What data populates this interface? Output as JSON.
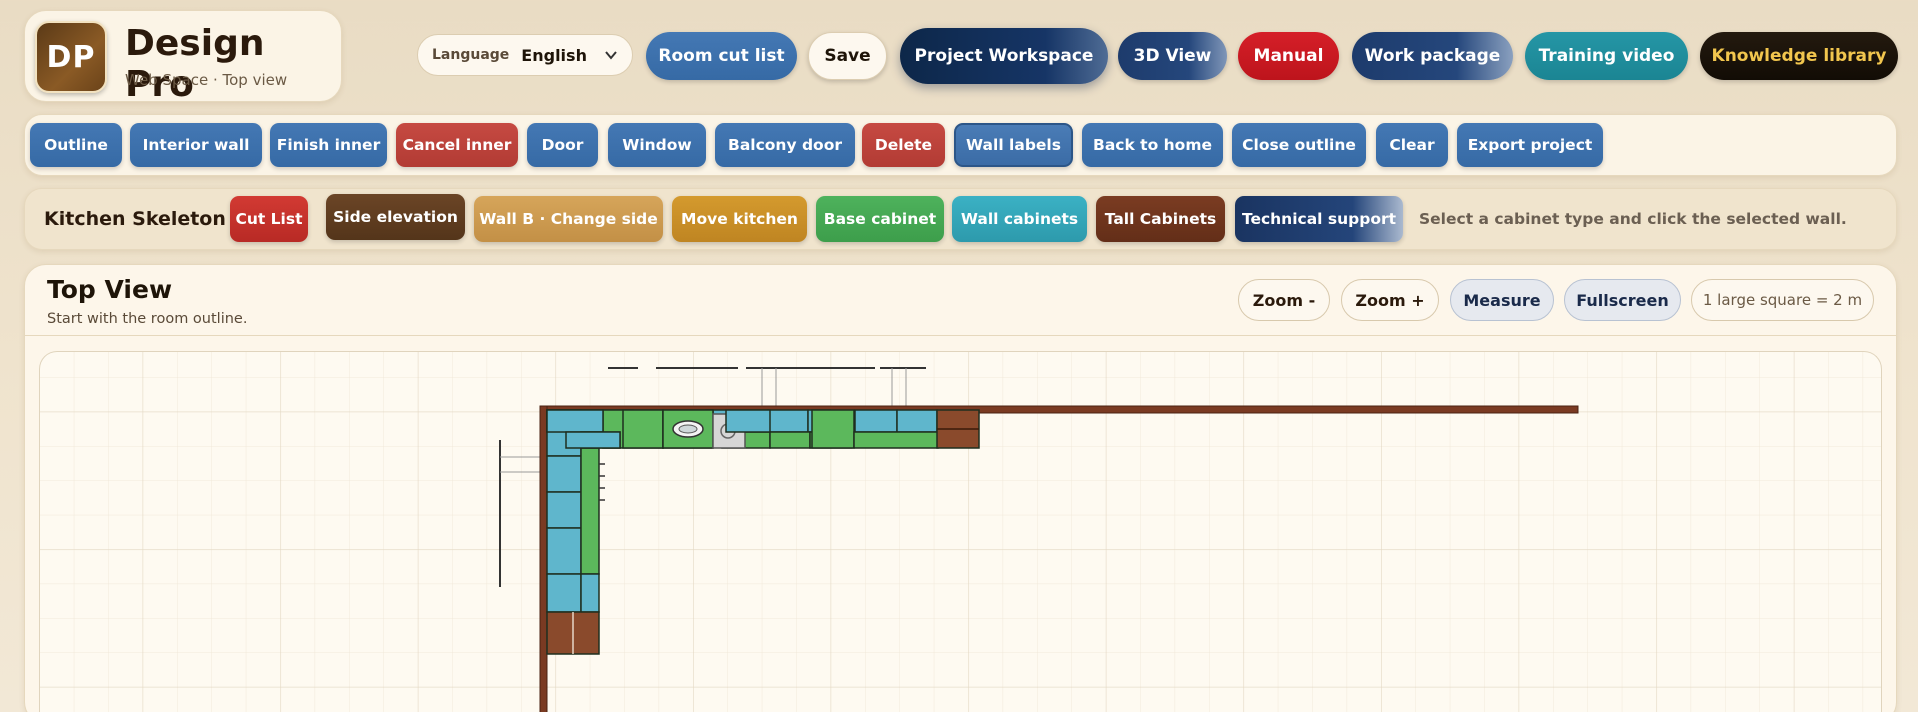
{
  "brand": {
    "logo": "DP",
    "title": "Design Pro",
    "subtitle": "Web Space · Top view"
  },
  "language": {
    "label": "Language",
    "value": "English"
  },
  "header_buttons": {
    "room_cut_list": "Room cut list",
    "save": "Save",
    "project_workspace": "Project Workspace",
    "view_3d": "3D View",
    "manual": "Manual",
    "work_package": "Work package",
    "training_video": "Training video",
    "knowledge_library": "Knowledge library"
  },
  "tools": {
    "outline": "Outline",
    "interior_wall": "Interior wall",
    "finish_inner": "Finish inner",
    "cancel_inner": "Cancel inner",
    "door": "Door",
    "window": "Window",
    "balcony_door": "Balcony door",
    "delete": "Delete",
    "wall_labels": "Wall labels",
    "back_to_home": "Back to home",
    "close_outline": "Close outline",
    "clear": "Clear",
    "export_project": "Export project"
  },
  "kitchen": {
    "label": "Kitchen Skeleton",
    "cut_list": "Cut List",
    "side_elevation": "Side elevation",
    "wall_b": "Wall B · Change side",
    "move_kitchen": "Move kitchen",
    "base_cabinet": "Base cabinet",
    "wall_cabinets": "Wall cabinets",
    "tall_cabinets": "Tall Cabinets",
    "technical_support": "Technical support",
    "hint": "Select a cabinet type and click the selected wall."
  },
  "topview": {
    "title": "Top View",
    "subtitle": "Start with the room outline.",
    "zoom_out": "Zoom -",
    "zoom_in": "Zoom +",
    "measure": "Measure",
    "fullscreen": "Fullscreen",
    "scale": "1 large square = 2 m"
  },
  "colors": {
    "wall": "#7a3a22",
    "base_cabinet": "#5cb85c",
    "wall_cabinet": "#5fb6cc",
    "tall_cabinet": "#8a4a2c",
    "grid_major": "#e6dcc8",
    "grid_minor": "#f3ecdf"
  }
}
